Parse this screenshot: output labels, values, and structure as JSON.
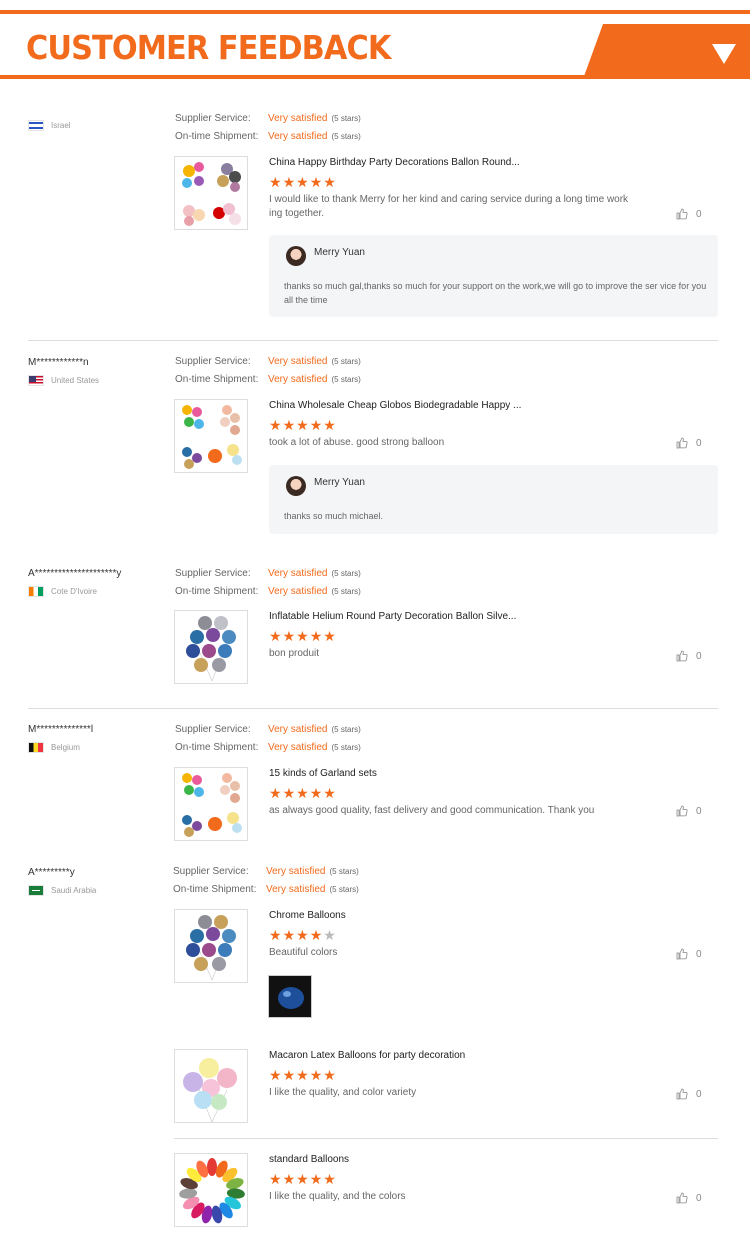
{
  "header": {
    "title": "CUSTOMER FEEDBACK"
  },
  "labels": {
    "supplier": "Supplier Service:",
    "shipment": "On-time Shipment:"
  },
  "reviews": [
    {
      "user": "",
      "country": "Israel",
      "supplier": {
        "value": "Very satisfied",
        "count": "(5 stars)"
      },
      "shipment": {
        "value": "Very satisfied",
        "count": "(5 stars)"
      },
      "product": "China Happy Birthday Party Decorations Ballon Round...",
      "stars": 5,
      "text": "I would like to thank Merry for her kind and caring service during a long time work ing together.",
      "likes": "0",
      "reply": {
        "name": "Merry Yuan",
        "text": "thanks so much gal,thanks so much for your support on the work,we will go to improve the ser vice for you all the time"
      }
    },
    {
      "user": "M************n",
      "country": "United States",
      "supplier": {
        "value": "Very satisfied",
        "count": "(5 stars)"
      },
      "shipment": {
        "value": "Very satisfied",
        "count": "(5 stars)"
      },
      "product": "China Wholesale Cheap Globos Biodegradable Happy ...",
      "stars": 5,
      "text": "took a lot of abuse. good strong balloon",
      "likes": "0",
      "reply": {
        "name": "Merry Yuan",
        "text": "thanks so much michael."
      }
    },
    {
      "user": "A*********************y",
      "country": "Cote D'Ivoire",
      "supplier": {
        "value": "Very satisfied",
        "count": "(5 stars)"
      },
      "shipment": {
        "value": "Very satisfied",
        "count": "(5 stars)"
      },
      "product": "Inflatable Helium Round Party Decoration Ballon Silve...",
      "stars": 5,
      "text": "bon produit",
      "likes": "0"
    },
    {
      "user": "M**************l",
      "country": "Belgium",
      "supplier": {
        "value": "Very satisfied",
        "count": "(5 stars)"
      },
      "shipment": {
        "value": "Very satisfied",
        "count": "(5 stars)"
      },
      "product": "15 kinds of Garland sets",
      "stars": 5,
      "text": "as always good quality, fast delivery and good communication. Thank you",
      "likes": "0"
    },
    {
      "user": "A*********y",
      "country": "Saudi Arabia",
      "supplier": {
        "value": "Very satisfied",
        "count": "(5 stars)"
      },
      "shipment": {
        "value": "Very satisfied",
        "count": "(5 stars)"
      },
      "products": [
        {
          "title": "Chrome Balloons",
          "stars": 4,
          "text": "Beautiful colors",
          "likes": "0"
        },
        {
          "title": "Macaron Latex Balloons for party decoration",
          "stars": 5,
          "text": "I like the quality, and color variety",
          "likes": "0"
        },
        {
          "title": "standard Balloons",
          "stars": 5,
          "text": "I like the quality, and the colors",
          "likes": "0"
        }
      ]
    }
  ],
  "colors": {
    "accent": "#f26a1b",
    "reply_bg": "#f4f5f7"
  },
  "icons": {
    "like": "thumbs-up-icon",
    "header_tab": "chevron-down-icon"
  }
}
